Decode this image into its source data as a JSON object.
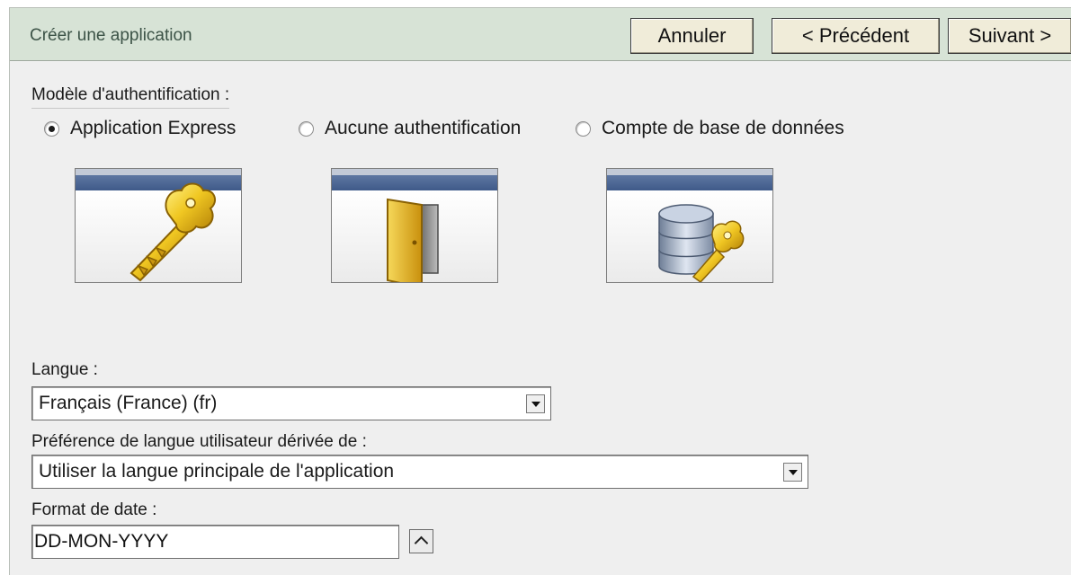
{
  "header": {
    "title": "Créer une application",
    "buttons": {
      "cancel": "Annuler",
      "previous": "< Précédent",
      "next": "Suivant >"
    }
  },
  "authentication": {
    "label": "Modèle d'authentification :",
    "selected": "Application Express",
    "options": [
      {
        "label": "Application Express",
        "icon": "key-icon",
        "checked": true
      },
      {
        "label": "Aucune authentification",
        "icon": "open-door-icon",
        "checked": false
      },
      {
        "label": "Compte de base de données",
        "icon": "database-key-icon",
        "checked": false
      }
    ]
  },
  "language": {
    "label": "Langue :",
    "value": "Français (France) (fr)"
  },
  "user_language_preference": {
    "label": "Préférence de langue utilisateur dérivée de :",
    "value": "Utiliser la langue principale de l'application"
  },
  "date_format": {
    "label": "Format de date :",
    "value": "DD-MON-YYYY"
  },
  "colors": {
    "header_background": "#d7e3d6",
    "header_title": "#3c5347",
    "button_background": "#f0ecd9",
    "panel_background": "#efefef",
    "image_strip": "#3f5a89",
    "key_gold": "#e2b81b"
  }
}
